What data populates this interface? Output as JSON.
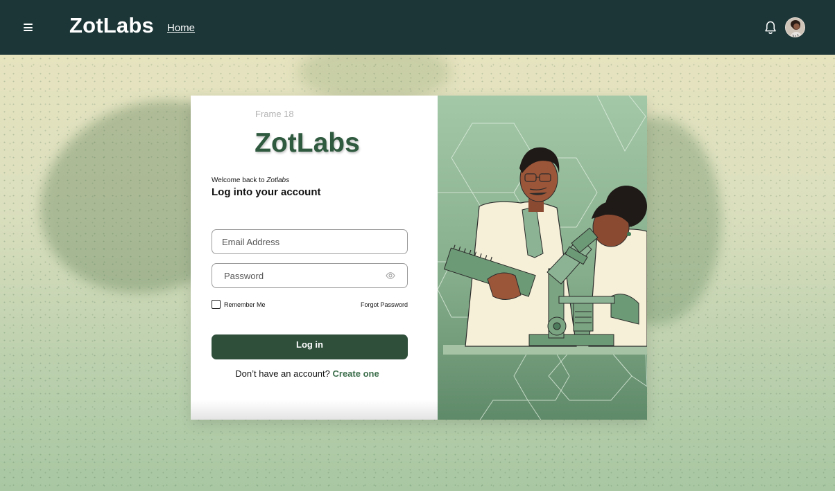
{
  "header": {
    "menu_icon": "hamburger-icon",
    "brand": "ZotLabs",
    "home_link": "Home",
    "notification_icon": "bell-icon",
    "avatar_icon": "user-avatar"
  },
  "card": {
    "frame_label": "Frame 18",
    "logo": "ZotLabs",
    "welcome_prefix": "Welcome back to ",
    "welcome_brand": "Zotlabs",
    "heading": "Log into your account",
    "email_placeholder": "Email Address",
    "password_placeholder": "Password",
    "password_icon": "eye-icon",
    "remember_label": "Remember Me",
    "remember_checked": false,
    "forgot_link": "Forgot Password",
    "login_button": "Log in",
    "signup_prompt": "Don’t have an account? ",
    "signup_link": "Create one",
    "illustration": "scientists-microscope-illustration"
  },
  "colors": {
    "topbar": "#1c3638",
    "brand_green": "#2f5a3f",
    "button": "#2f4f3b",
    "link": "#3c6e4b"
  }
}
